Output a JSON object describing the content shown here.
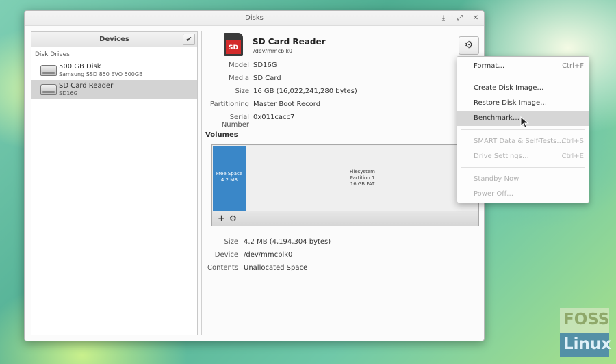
{
  "window": {
    "title": "Disks",
    "controls": {
      "download": "⤓",
      "maximize": "⤢",
      "close": "✕"
    }
  },
  "sidebar": {
    "header": "Devices",
    "check_symbol": "✔",
    "section_label": "Disk Drives",
    "drives": [
      {
        "name": "500 GB Disk",
        "subtitle": "Samsung SSD 850 EVO 500GB",
        "icon": "harddisk-icon",
        "selected": false
      },
      {
        "name": "SD Card Reader",
        "subtitle": "SD16G",
        "icon": "harddisk-icon",
        "selected": true
      }
    ]
  },
  "disk": {
    "title": "SD Card Reader",
    "device_path": "/dev/mmcblk0",
    "icon_label": "SD",
    "gear_symbol": "⚙",
    "properties": [
      {
        "label": "Model",
        "value": "SD16G"
      },
      {
        "label": "Media",
        "value": "SD Card"
      },
      {
        "label": "Size",
        "value": "16 GB (16,022,241,280 bytes)"
      },
      {
        "label": "Partitioning",
        "value": "Master Boot Record"
      },
      {
        "label": "Serial Number",
        "value": "0x011cacc7"
      }
    ]
  },
  "volumes": {
    "title": "Volumes",
    "free_space": {
      "line1": "Free Space",
      "line2": "4.2 MB",
      "color": "#3a87c8"
    },
    "partition": {
      "line1": "Filesystem",
      "line2": "Partition 1",
      "line3": "16 GB FAT"
    },
    "toolbar": {
      "add_symbol": "+",
      "settings_symbol": "⚙"
    },
    "properties": [
      {
        "label": "Size",
        "value": "4.2 MB (4,194,304 bytes)"
      },
      {
        "label": "Device",
        "value": "/dev/mmcblk0"
      },
      {
        "label": "Contents",
        "value": "Unallocated Space"
      }
    ]
  },
  "menu": {
    "items": [
      {
        "label": "Format…",
        "accel": "Ctrl+F",
        "disabled": false
      },
      {
        "label": "Create Disk Image…",
        "accel": "",
        "disabled": false
      },
      {
        "label": "Restore Disk Image…",
        "accel": "",
        "disabled": false
      },
      {
        "label": "Benchmark…",
        "accel": "",
        "disabled": false,
        "hover": true
      },
      {
        "label": "SMART Data & Self-Tests…",
        "accel": "Ctrl+S",
        "disabled": true
      },
      {
        "label": "Drive Settings…",
        "accel": "Ctrl+E",
        "disabled": true
      },
      {
        "label": "Standby Now",
        "accel": "",
        "disabled": true
      },
      {
        "label": "Power Off…",
        "accel": "",
        "disabled": true
      }
    ]
  },
  "watermark": {
    "line1": "FOSS",
    "line2": "Linux"
  }
}
